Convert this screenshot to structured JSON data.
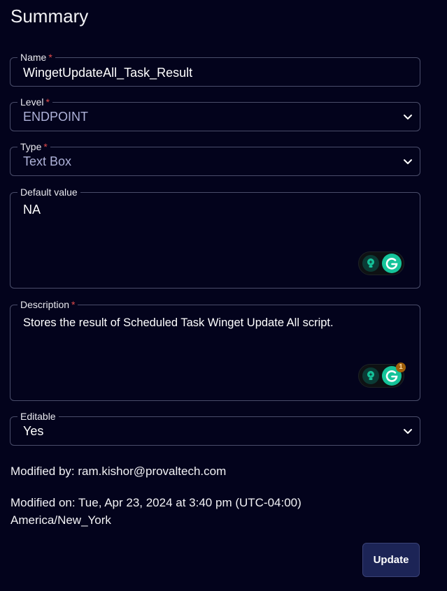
{
  "page": {
    "title": "Summary"
  },
  "fields": {
    "name": {
      "label": "Name",
      "required_mark": "*",
      "value": "WingetUpdateAll_Task_Result"
    },
    "level": {
      "label": "Level",
      "required_mark": "*",
      "value": "ENDPOINT"
    },
    "type": {
      "label": "Type",
      "required_mark": "*",
      "value": "Text Box"
    },
    "default_value": {
      "label": "Default value",
      "value": "NA"
    },
    "description": {
      "label": "Description",
      "required_mark": "*",
      "value": "Stores the result of Scheduled Task Winget Update All script.",
      "grammarly_badge_count": "1"
    },
    "editable": {
      "label": "Editable",
      "value": "Yes"
    }
  },
  "meta": {
    "modified_by": "Modified by: ram.kishor@provaltech.com",
    "modified_on_line1": "Modified on: Tue, Apr 23, 2024 at 3:40 pm (UTC-04:00)",
    "modified_on_line2": "America/New_York"
  },
  "actions": {
    "update_label": "Update"
  },
  "colors": {
    "background": "#03031c",
    "border": "#4a4d6a",
    "required": "#e24b4b",
    "button_bg": "#1c2456",
    "grammarly_green": "#15c39a"
  },
  "icons": [
    "chevron-down-icon",
    "grammarly-lightbulb-icon",
    "grammarly-g-icon"
  ]
}
